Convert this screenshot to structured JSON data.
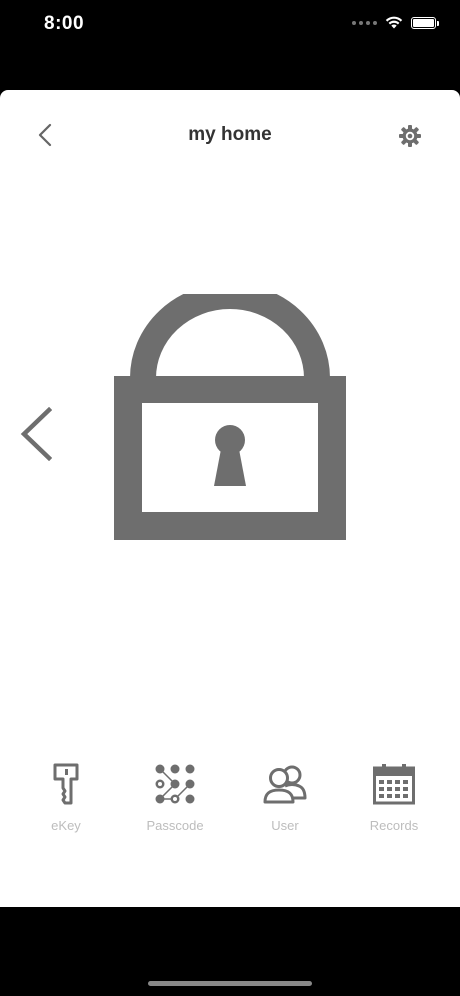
{
  "status_bar": {
    "time": "8:00"
  },
  "header": {
    "title": "my home",
    "back_icon": "chevron-left-icon",
    "settings_icon": "gear-icon"
  },
  "lock": {
    "icon": "padlock-icon",
    "prev_icon": "chevron-left-icon"
  },
  "tabs": [
    {
      "label": "eKey",
      "icon": "key-icon"
    },
    {
      "label": "Passcode",
      "icon": "keypad-icon"
    },
    {
      "label": "User",
      "icon": "users-icon"
    },
    {
      "label": "Records",
      "icon": "calendar-icon"
    }
  ],
  "colors": {
    "icon_gray": "#6e6e6e",
    "label_gray": "#bdbdbd",
    "title_dark": "#333333"
  }
}
